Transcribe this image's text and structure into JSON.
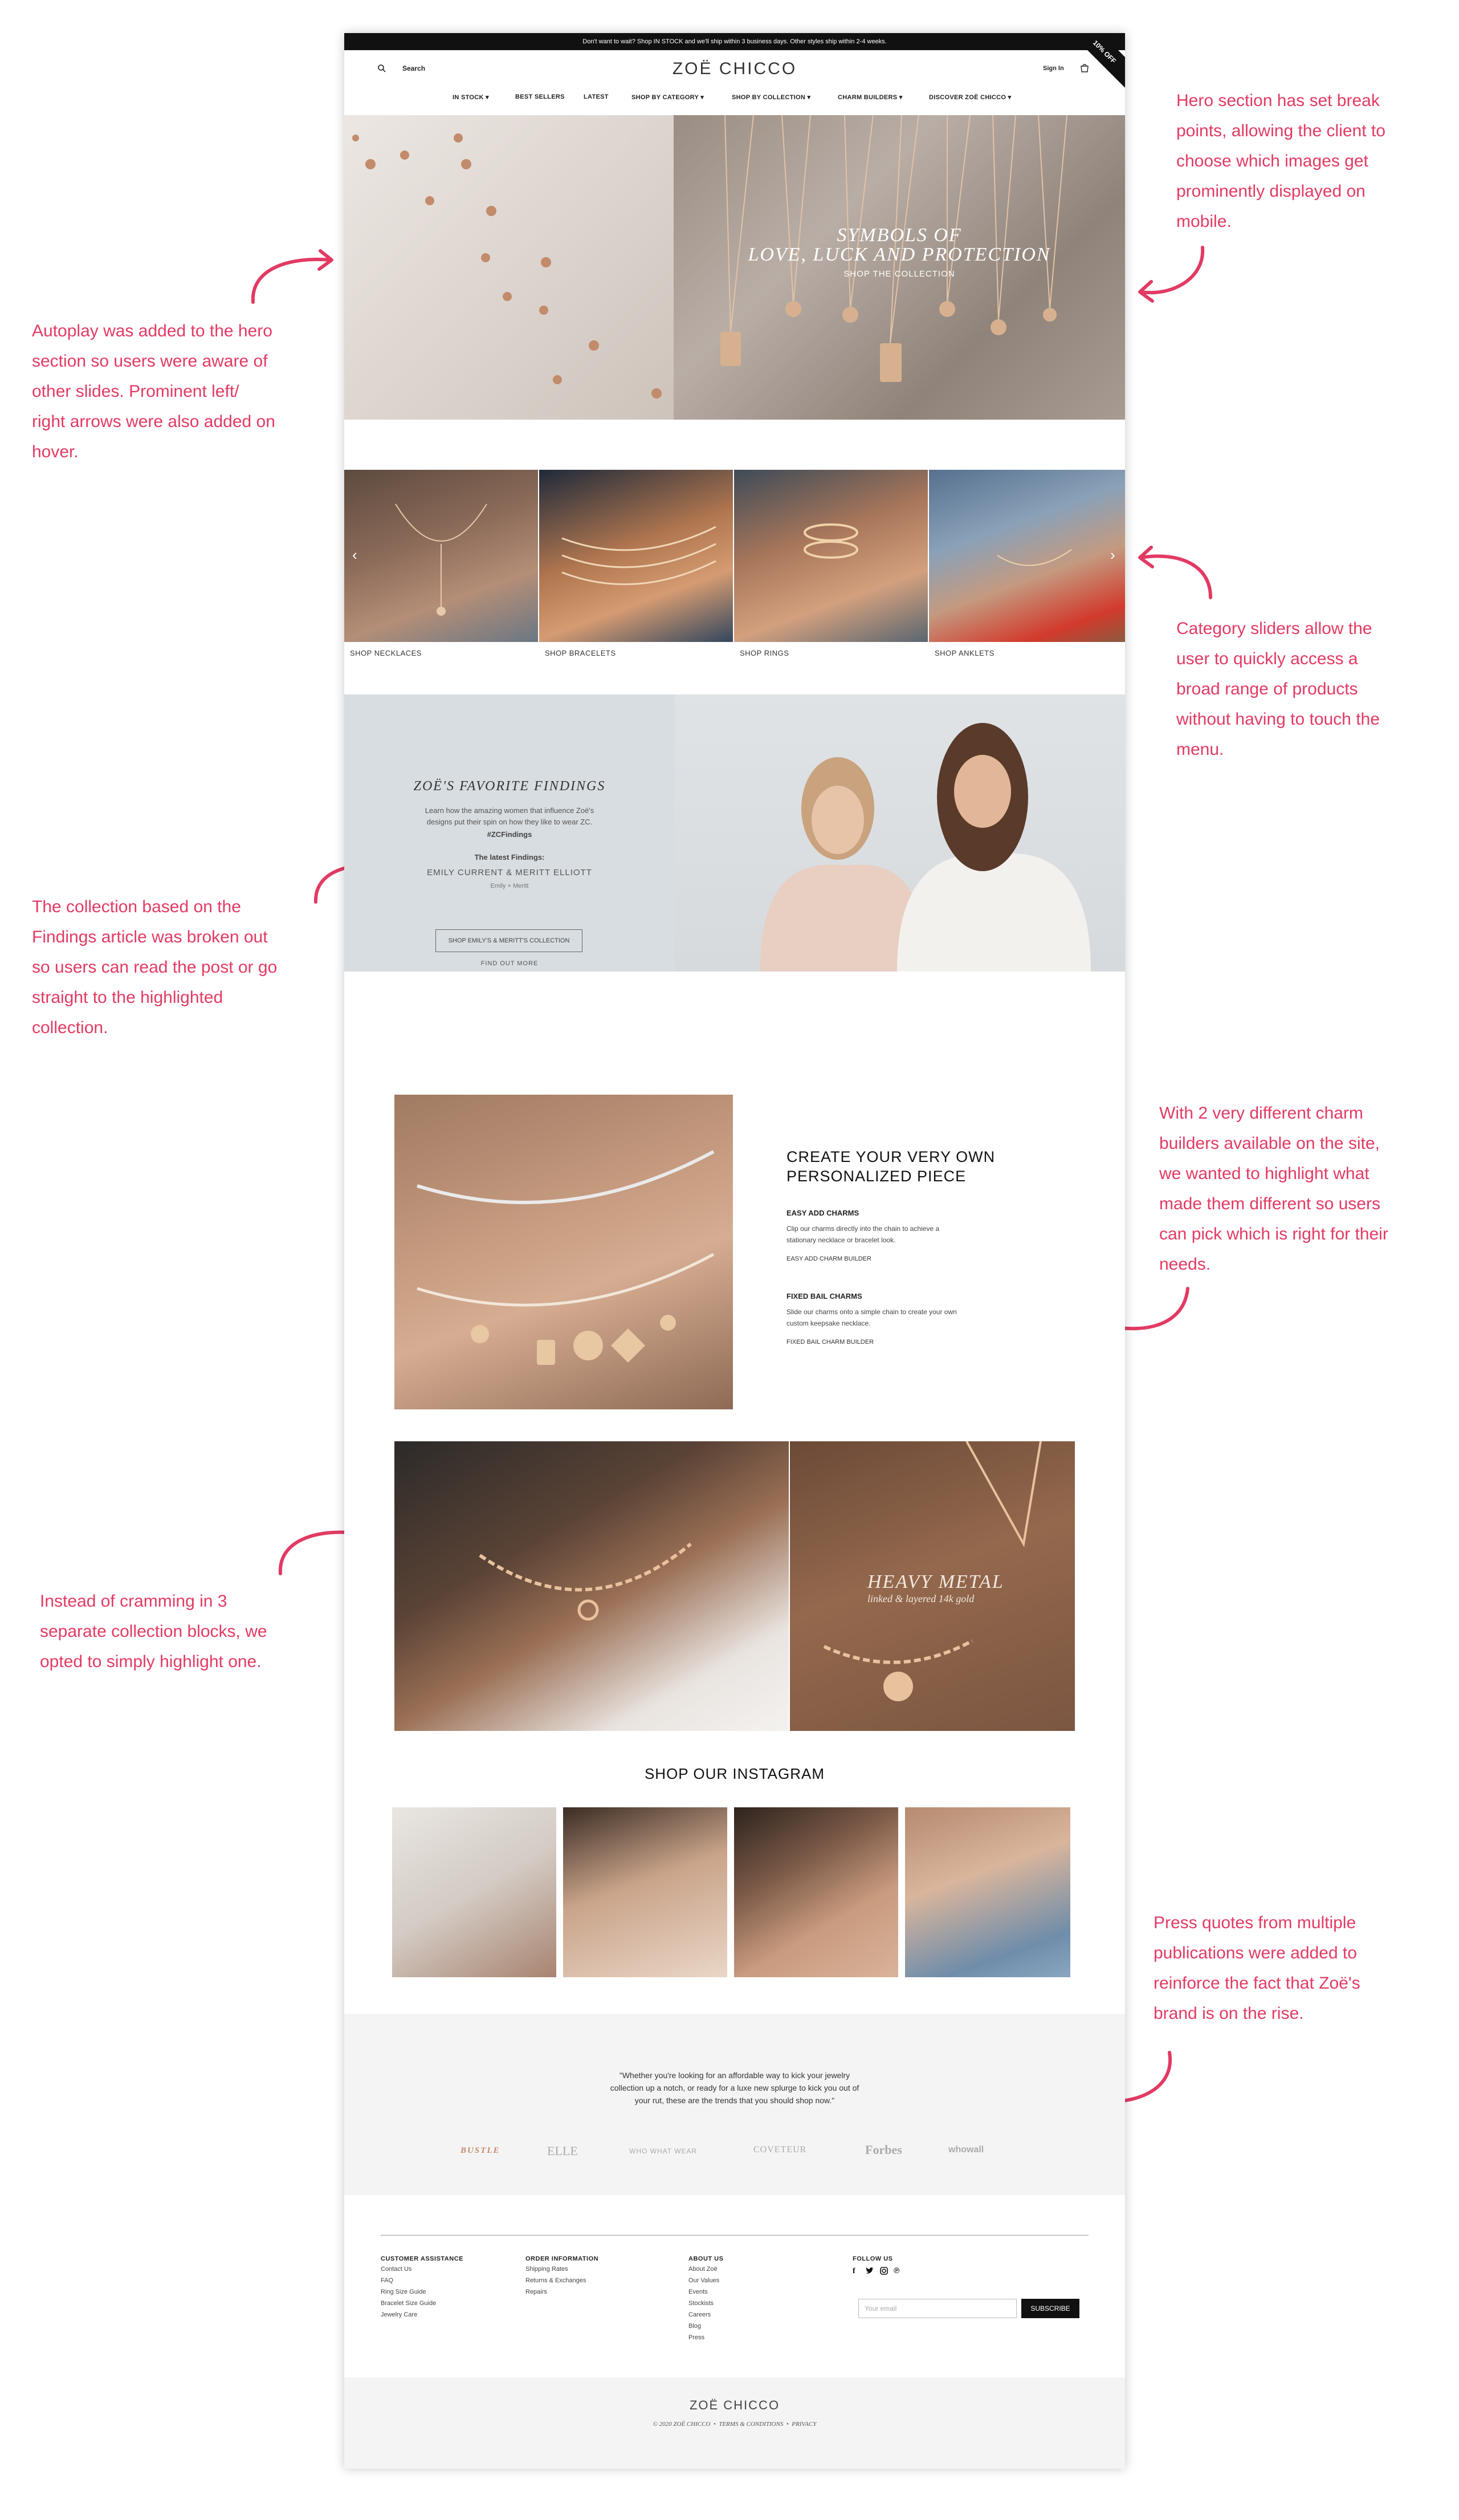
{
  "annotations": {
    "hero_autoplay": [
      "Autoplay was added to the hero",
      "section so users were aware of",
      "other slides. Prominent left/",
      "right arrows were also added on",
      "hover."
    ],
    "hero_breakpoints": [
      "Hero section has set break",
      "points, allowing the client to",
      "choose which images get",
      "prominently displayed on",
      "mobile."
    ],
    "category_sliders": [
      "Category sliders allow the",
      "user to quickly access a",
      "broad range of products",
      "without having to touch the",
      "menu."
    ],
    "findings": [
      "The collection based on the",
      "Findings article was broken out",
      "so users can read the post or go",
      "straight to the highlighted",
      "collection."
    ],
    "charm_builders": [
      "With 2 very different charm",
      "builders available on the site,",
      "we wanted to highlight what",
      "made them different so users",
      "can pick which is right for their",
      "needs."
    ],
    "collection_blocks": [
      "Instead of cramming in 3",
      "separate collection blocks, we",
      "opted to simply highlight one."
    ],
    "press": [
      "Press quotes from multiple",
      "publications were added to",
      "reinforce the fact that Zoë's",
      "brand is on the rise."
    ]
  },
  "site": {
    "announcement": "Don't want to wait? Shop IN STOCK and we'll ship within 3 business days. Other styles ship within 2-4 weeks.",
    "ribbon": "10% OFF",
    "search_label": "Search",
    "logo": "ZOË CHICCO",
    "sign_in": "Sign In",
    "nav": [
      "IN STOCK",
      "BEST SELLERS",
      "LATEST",
      "SHOP BY CATEGORY",
      "SHOP BY COLLECTION",
      "CHARM BUILDERS",
      "DISCOVER ZOË CHICCO"
    ]
  },
  "hero": {
    "title_line1": "SYMBOLS OF",
    "title_line2": "LOVE, LUCK AND PROTECTION",
    "cta": "SHOP THE COLLECTION"
  },
  "categories": [
    "SHOP NECKLACES",
    "SHOP BRACELETS",
    "SHOP RINGS",
    "SHOP ANKLETS"
  ],
  "findings": {
    "title": "ZOË'S FAVORITE FINDINGS",
    "body_line1": "Learn how the amazing women that influence Zoë's",
    "body_line2": "designs put their spin on how they like to wear ZC.",
    "hashtag": "#ZCFindings",
    "latest_label": "The latest Findings:",
    "names": "EMILY CURRENT & MERITT ELLIOTT",
    "sub": "Emily + Meritt",
    "button": "SHOP EMILY'S & MERITT'S COLLECTION",
    "find_more": "FIND OUT MORE"
  },
  "personalized": {
    "title_line1": "CREATE YOUR VERY OWN",
    "title_line2": "PERSONALIZED PIECE",
    "easy_title": "EASY ADD CHARMS",
    "easy_body_line1": "Clip our charms directly into the chain to achieve a",
    "easy_body_line2": "stationary necklace or bracelet look.",
    "easy_link": "EASY ADD CHARM BUILDER",
    "fixed_title": "FIXED BAIL CHARMS",
    "fixed_body_line1": "Slide our charms onto a simple chain to create your own",
    "fixed_body_line2": "custom keepsake necklace.",
    "fixed_link": "FIXED BAIL CHARM BUILDER"
  },
  "heavy_metal": {
    "title": "HEAVY METAL",
    "subtitle": "linked & layered 14k gold"
  },
  "instagram": {
    "title": "SHOP OUR INSTAGRAM"
  },
  "press": {
    "quote_line1": "\"Whether you're looking for an affordable way to kick your jewelry",
    "quote_line2": "collection up a notch, or ready for a luxe new splurge to kick you out of",
    "quote_line3": "your rut, these are the trends that you should shop now.\"",
    "logos": [
      "BUSTLE",
      "ELLE",
      "WHO WHAT WEAR",
      "COVETEUR",
      "Forbes",
      "whowall"
    ]
  },
  "footer": {
    "col1_title": "CUSTOMER ASSISTANCE",
    "col1": [
      "Contact Us",
      "FAQ",
      "Ring Size Guide",
      "Bracelet Size Guide",
      "Jewelry Care"
    ],
    "col2_title": "ORDER INFORMATION",
    "col2": [
      "Shipping Rates",
      "Returns & Exchanges",
      "Repairs"
    ],
    "col3_title": "ABOUT US",
    "col3": [
      "About Zoë",
      "Our Values",
      "Events",
      "Stockists",
      "Careers",
      "Blog",
      "Press"
    ],
    "follow_title": "FOLLOW US",
    "email_placeholder": "Your email",
    "subscribe": "SUBSCRIBE",
    "logo": "ZOË CHICCO",
    "copyright": "© 2020 ZOË CHICCO",
    "terms": "TERMS & CONDITIONS",
    "privacy": "PRIVACY"
  },
  "colors": {
    "accent": "#e23a63",
    "dark": "#111111",
    "findings_bg": "#d8dde1",
    "press_bg": "#f4f4f4"
  }
}
